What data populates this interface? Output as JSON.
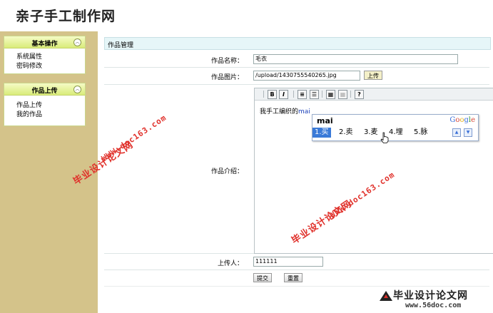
{
  "header": {
    "site_title": "亲子手工制作网"
  },
  "sidebar": {
    "panels": [
      {
        "title": "基本操作",
        "items": [
          "系统属性",
          "密码修改"
        ]
      },
      {
        "title": "作品上传",
        "items": [
          "作品上传",
          "我的作品"
        ]
      }
    ]
  },
  "main": {
    "section_title": "作品管理",
    "fields": {
      "name": {
        "label": "作品名称：",
        "value": "毛衣"
      },
      "image": {
        "label": "作品图片：",
        "value": "/upload/1430755540265.jpg",
        "button": "上传"
      },
      "intro": {
        "label": "作品介绍："
      },
      "uploader": {
        "label": "上传人：",
        "value": "111111"
      }
    },
    "editor": {
      "toolbar": [
        "B",
        "I"
      ],
      "content_prefix": "我手工编织的",
      "content_typed": "mai"
    },
    "buttons": {
      "submit": "提交",
      "reset": "重置"
    }
  },
  "ime": {
    "input": "mai",
    "brand": [
      "G",
      "o",
      "o",
      "g",
      "l",
      "e"
    ],
    "candidates": [
      "1.买",
      "2.卖",
      "3.麦",
      "4.埋",
      "5.脉"
    ]
  },
  "watermarks": {
    "site_name": "毕业设计论文网",
    "url": "WWW.doc163.com",
    "logo_name": "毕业设计论文网",
    "logo_url": "www.56doc.com"
  },
  "colors": {
    "sidebar_bg": "#d4c38a",
    "panel_head": "#d9ec7a",
    "header_bar": "#e6f6f8",
    "ime_selected": "#3a7ad8",
    "watermark": "#e0302a"
  }
}
